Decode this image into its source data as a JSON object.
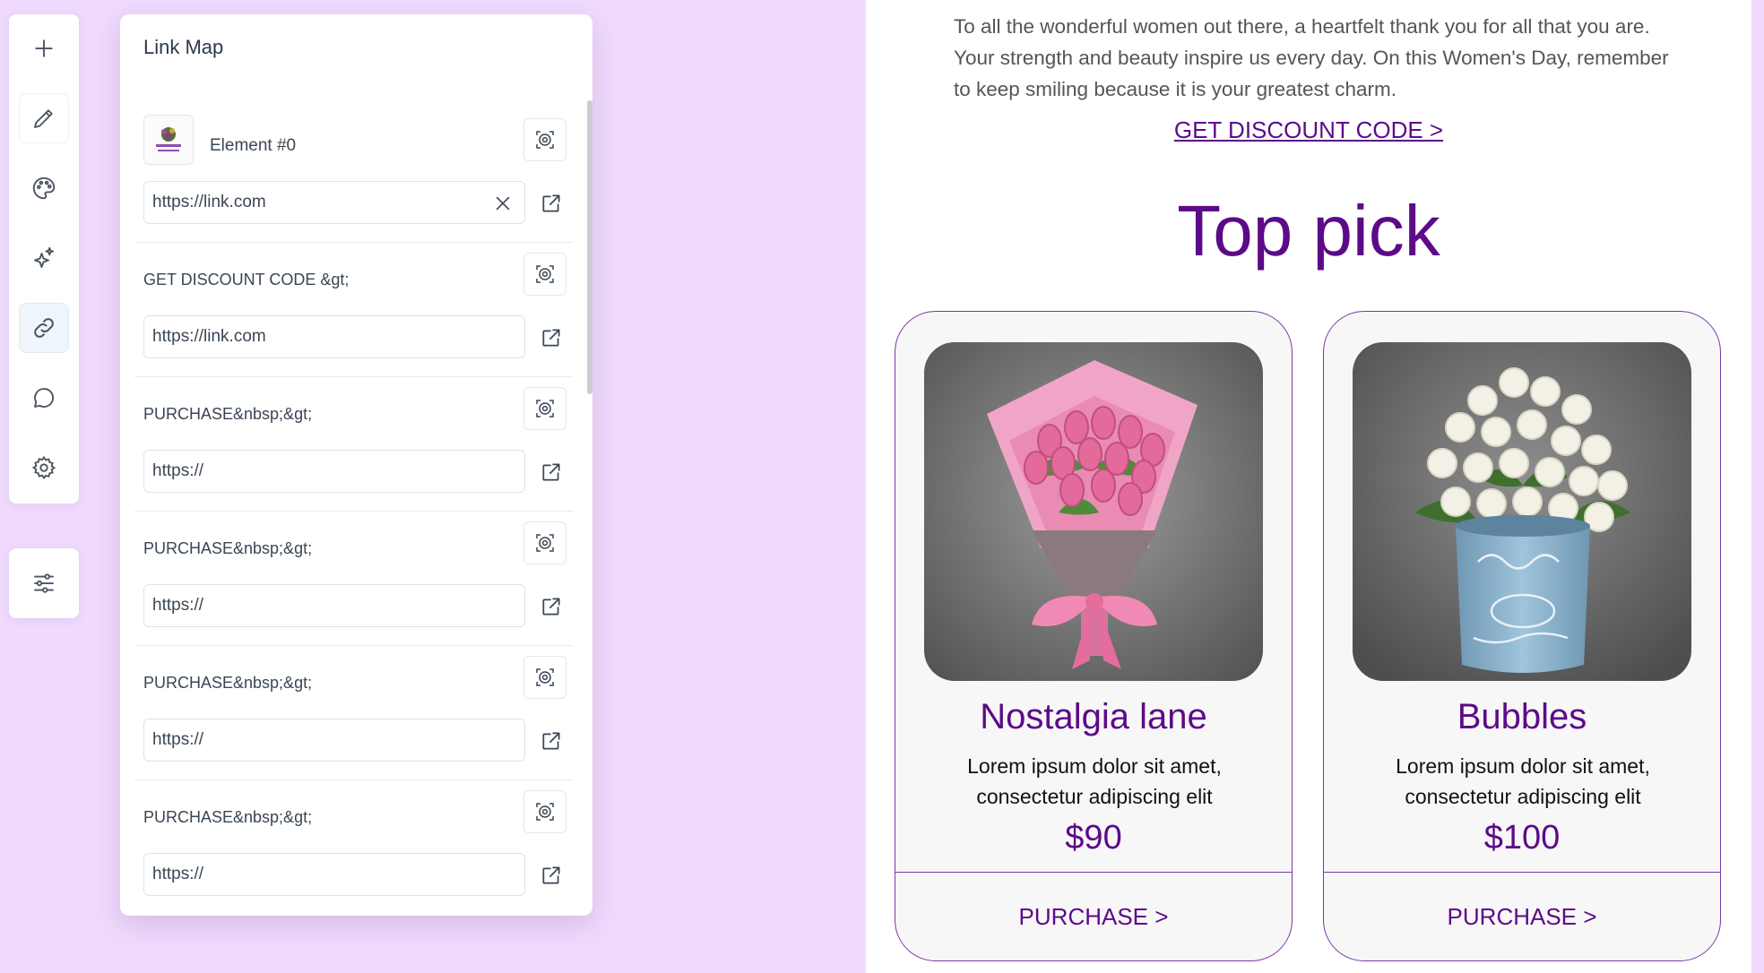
{
  "sidebar": {
    "tools": [
      {
        "name": "add",
        "icon": "plus-icon"
      },
      {
        "name": "edit",
        "icon": "pencil-icon"
      },
      {
        "name": "theme",
        "icon": "palette-icon"
      },
      {
        "name": "ai",
        "icon": "sparkles-icon"
      },
      {
        "name": "links",
        "icon": "link-icon",
        "active": true
      },
      {
        "name": "comments",
        "icon": "chat-bubble-icon"
      },
      {
        "name": "settings",
        "icon": "gear-icon"
      }
    ],
    "secondary_tool": {
      "name": "adjustments",
      "icon": "sliders-icon"
    }
  },
  "link_map": {
    "title": "Link Map",
    "rows": [
      {
        "label": "Element #0",
        "has_thumbnail": true,
        "url": "https://link.com",
        "has_clear": true
      },
      {
        "label": "GET DISCOUNT CODE &gt;",
        "url": "https://link.com"
      },
      {
        "label": "PURCHASE&nbsp;&gt;",
        "url": "https://"
      },
      {
        "label": "PURCHASE&nbsp;&gt;",
        "url": "https://"
      },
      {
        "label": "PURCHASE&nbsp;&gt;",
        "url": "https://"
      },
      {
        "label": "PURCHASE&nbsp;&gt;",
        "url": "https://"
      }
    ]
  },
  "email": {
    "intro_text": "To all the wonderful women out there, a heartfelt thank you for all that you are. Your strength and beauty inspire us every day. On this Women's Day, remember to keep smiling because it is your greatest charm.",
    "discount_link": "GET DISCOUNT CODE >",
    "section_title": "Top pick",
    "products": [
      {
        "name": "Nostalgia lane",
        "description": "Lorem ipsum dolor sit amet, consectetur adipiscing elit",
        "price": "$90",
        "button": "PURCHASE >",
        "image": "pink-tulip-bouquet"
      },
      {
        "name": "Bubbles",
        "description": "Lorem ipsum dolor sit amet, consectetur adipiscing elit",
        "price": "$100",
        "button": "PURCHASE >",
        "image": "white-roses-in-blue-vase"
      }
    ]
  },
  "colors": {
    "background": "#efd9fc",
    "accent_purple": "#5c0a88",
    "card_border": "#7a36a8",
    "panel_text": "#3a4654"
  }
}
